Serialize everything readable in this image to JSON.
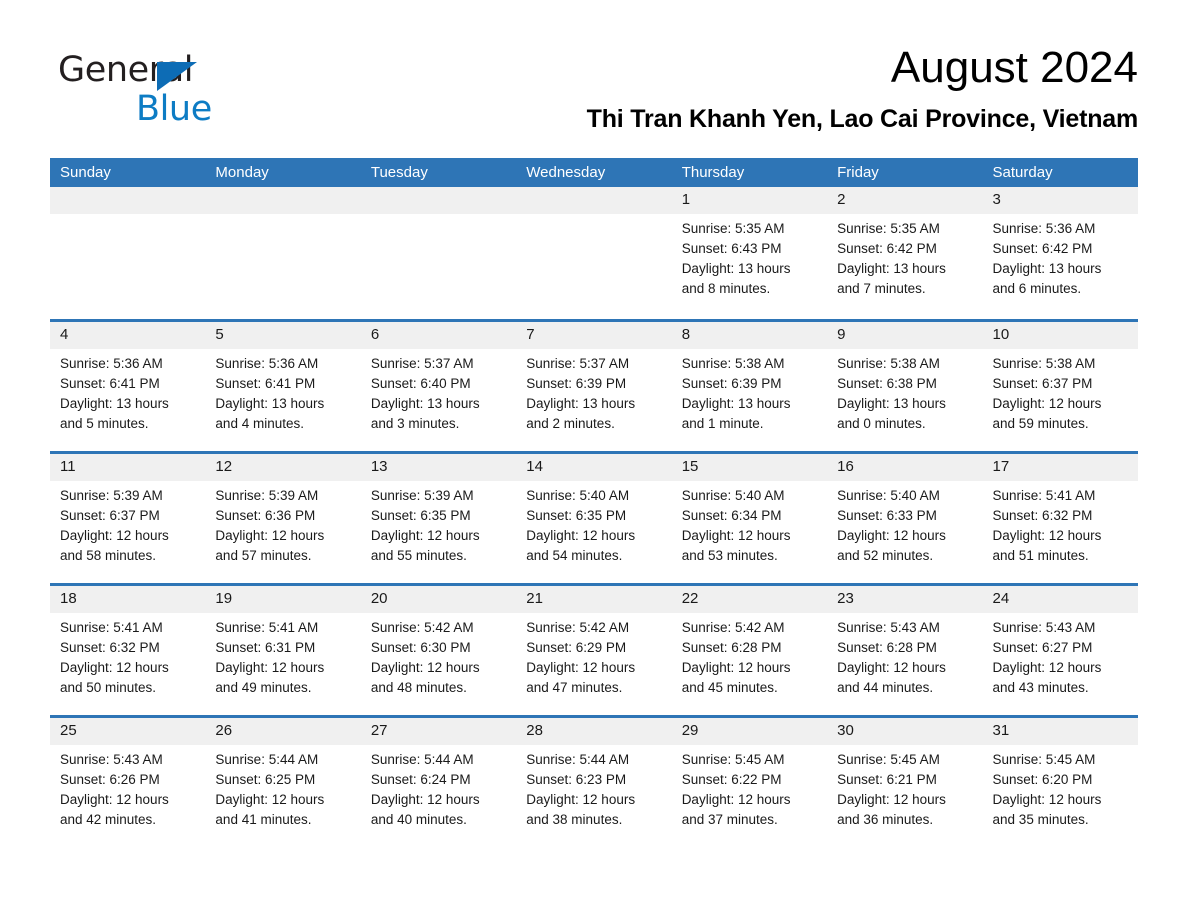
{
  "brand": {
    "name_part1": "General",
    "name_part2": "Blue",
    "logo_blue": "#0d7cc4",
    "triangle_blue": "#0d6cb5"
  },
  "header": {
    "month_title": "August 2024",
    "location": "Thi Tran Khanh Yen, Lao Cai Province, Vietnam"
  },
  "theme": {
    "header_blue": "#2e75b6",
    "day_band_gray": "#f0f0f0",
    "cell_white": "#ffffff",
    "text_black": "#1a1a1a"
  },
  "calendar": {
    "weekdays": [
      "Sunday",
      "Monday",
      "Tuesday",
      "Wednesday",
      "Thursday",
      "Friday",
      "Saturday"
    ],
    "weeks": [
      [
        {
          "day": "",
          "lines": []
        },
        {
          "day": "",
          "lines": []
        },
        {
          "day": "",
          "lines": []
        },
        {
          "day": "",
          "lines": []
        },
        {
          "day": "1",
          "lines": [
            "Sunrise: 5:35 AM",
            "Sunset: 6:43 PM",
            "Daylight: 13 hours",
            "and 8 minutes."
          ]
        },
        {
          "day": "2",
          "lines": [
            "Sunrise: 5:35 AM",
            "Sunset: 6:42 PM",
            "Daylight: 13 hours",
            "and 7 minutes."
          ]
        },
        {
          "day": "3",
          "lines": [
            "Sunrise: 5:36 AM",
            "Sunset: 6:42 PM",
            "Daylight: 13 hours",
            "and 6 minutes."
          ]
        }
      ],
      [
        {
          "day": "4",
          "lines": [
            "Sunrise: 5:36 AM",
            "Sunset: 6:41 PM",
            "Daylight: 13 hours",
            "and 5 minutes."
          ]
        },
        {
          "day": "5",
          "lines": [
            "Sunrise: 5:36 AM",
            "Sunset: 6:41 PM",
            "Daylight: 13 hours",
            "and 4 minutes."
          ]
        },
        {
          "day": "6",
          "lines": [
            "Sunrise: 5:37 AM",
            "Sunset: 6:40 PM",
            "Daylight: 13 hours",
            "and 3 minutes."
          ]
        },
        {
          "day": "7",
          "lines": [
            "Sunrise: 5:37 AM",
            "Sunset: 6:39 PM",
            "Daylight: 13 hours",
            "and 2 minutes."
          ]
        },
        {
          "day": "8",
          "lines": [
            "Sunrise: 5:38 AM",
            "Sunset: 6:39 PM",
            "Daylight: 13 hours",
            "and 1 minute."
          ]
        },
        {
          "day": "9",
          "lines": [
            "Sunrise: 5:38 AM",
            "Sunset: 6:38 PM",
            "Daylight: 13 hours",
            "and 0 minutes."
          ]
        },
        {
          "day": "10",
          "lines": [
            "Sunrise: 5:38 AM",
            "Sunset: 6:37 PM",
            "Daylight: 12 hours",
            "and 59 minutes."
          ]
        }
      ],
      [
        {
          "day": "11",
          "lines": [
            "Sunrise: 5:39 AM",
            "Sunset: 6:37 PM",
            "Daylight: 12 hours",
            "and 58 minutes."
          ]
        },
        {
          "day": "12",
          "lines": [
            "Sunrise: 5:39 AM",
            "Sunset: 6:36 PM",
            "Daylight: 12 hours",
            "and 57 minutes."
          ]
        },
        {
          "day": "13",
          "lines": [
            "Sunrise: 5:39 AM",
            "Sunset: 6:35 PM",
            "Daylight: 12 hours",
            "and 55 minutes."
          ]
        },
        {
          "day": "14",
          "lines": [
            "Sunrise: 5:40 AM",
            "Sunset: 6:35 PM",
            "Daylight: 12 hours",
            "and 54 minutes."
          ]
        },
        {
          "day": "15",
          "lines": [
            "Sunrise: 5:40 AM",
            "Sunset: 6:34 PM",
            "Daylight: 12 hours",
            "and 53 minutes."
          ]
        },
        {
          "day": "16",
          "lines": [
            "Sunrise: 5:40 AM",
            "Sunset: 6:33 PM",
            "Daylight: 12 hours",
            "and 52 minutes."
          ]
        },
        {
          "day": "17",
          "lines": [
            "Sunrise: 5:41 AM",
            "Sunset: 6:32 PM",
            "Daylight: 12 hours",
            "and 51 minutes."
          ]
        }
      ],
      [
        {
          "day": "18",
          "lines": [
            "Sunrise: 5:41 AM",
            "Sunset: 6:32 PM",
            "Daylight: 12 hours",
            "and 50 minutes."
          ]
        },
        {
          "day": "19",
          "lines": [
            "Sunrise: 5:41 AM",
            "Sunset: 6:31 PM",
            "Daylight: 12 hours",
            "and 49 minutes."
          ]
        },
        {
          "day": "20",
          "lines": [
            "Sunrise: 5:42 AM",
            "Sunset: 6:30 PM",
            "Daylight: 12 hours",
            "and 48 minutes."
          ]
        },
        {
          "day": "21",
          "lines": [
            "Sunrise: 5:42 AM",
            "Sunset: 6:29 PM",
            "Daylight: 12 hours",
            "and 47 minutes."
          ]
        },
        {
          "day": "22",
          "lines": [
            "Sunrise: 5:42 AM",
            "Sunset: 6:28 PM",
            "Daylight: 12 hours",
            "and 45 minutes."
          ]
        },
        {
          "day": "23",
          "lines": [
            "Sunrise: 5:43 AM",
            "Sunset: 6:28 PM",
            "Daylight: 12 hours",
            "and 44 minutes."
          ]
        },
        {
          "day": "24",
          "lines": [
            "Sunrise: 5:43 AM",
            "Sunset: 6:27 PM",
            "Daylight: 12 hours",
            "and 43 minutes."
          ]
        }
      ],
      [
        {
          "day": "25",
          "lines": [
            "Sunrise: 5:43 AM",
            "Sunset: 6:26 PM",
            "Daylight: 12 hours",
            "and 42 minutes."
          ]
        },
        {
          "day": "26",
          "lines": [
            "Sunrise: 5:44 AM",
            "Sunset: 6:25 PM",
            "Daylight: 12 hours",
            "and 41 minutes."
          ]
        },
        {
          "day": "27",
          "lines": [
            "Sunrise: 5:44 AM",
            "Sunset: 6:24 PM",
            "Daylight: 12 hours",
            "and 40 minutes."
          ]
        },
        {
          "day": "28",
          "lines": [
            "Sunrise: 5:44 AM",
            "Sunset: 6:23 PM",
            "Daylight: 12 hours",
            "and 38 minutes."
          ]
        },
        {
          "day": "29",
          "lines": [
            "Sunrise: 5:45 AM",
            "Sunset: 6:22 PM",
            "Daylight: 12 hours",
            "and 37 minutes."
          ]
        },
        {
          "day": "30",
          "lines": [
            "Sunrise: 5:45 AM",
            "Sunset: 6:21 PM",
            "Daylight: 12 hours",
            "and 36 minutes."
          ]
        },
        {
          "day": "31",
          "lines": [
            "Sunrise: 5:45 AM",
            "Sunset: 6:20 PM",
            "Daylight: 12 hours",
            "and 35 minutes."
          ]
        }
      ]
    ]
  }
}
